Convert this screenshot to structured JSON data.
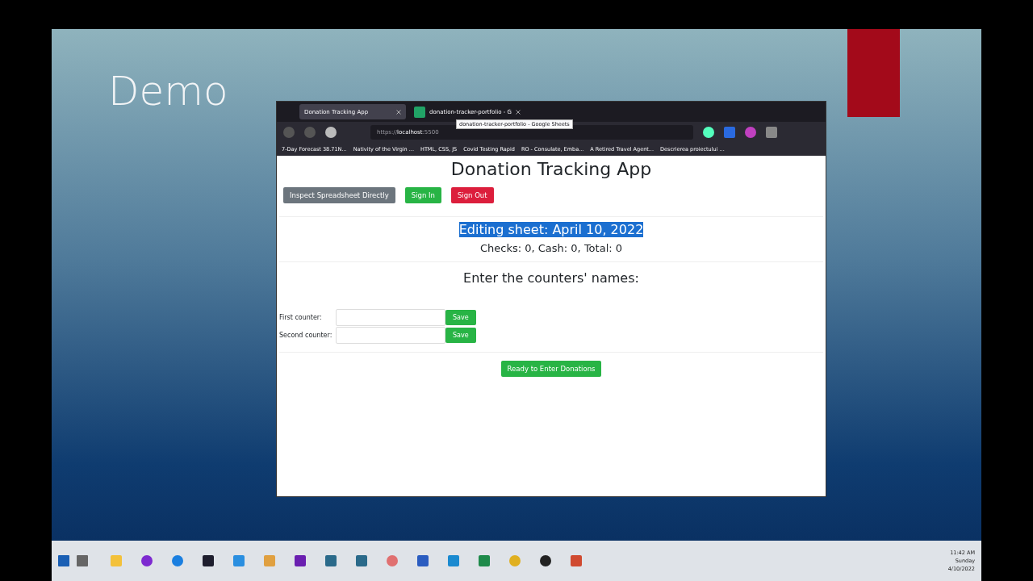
{
  "slide": {
    "title": "Demo"
  },
  "browser": {
    "tabs": [
      {
        "label": "Donation Tracking App",
        "selected": true
      },
      {
        "label": "donation-tracker-portfolio - G",
        "selected": false
      }
    ],
    "tooltip": "donation-tracker-portfolio - Google Sheets",
    "url_prefix": "https://",
    "url_host": "localhost",
    "url_port": ":5500",
    "bookmarks": [
      "7-Day Forecast 38.71N...",
      "Nativity of the Virgin ...",
      "HTML, CSS, JS",
      "Covid Testing Rapid",
      "RO - Consulate, Emba...",
      "A Retired Travel Agent...",
      "Descrierea proiectului ..."
    ]
  },
  "page": {
    "title": "Donation Tracking App",
    "buttons": [
      {
        "label": "Inspect Spreadsheet Directly",
        "kind": "secondary"
      },
      {
        "label": "Sign In",
        "kind": "success"
      },
      {
        "label": "Sign Out",
        "kind": "danger"
      }
    ],
    "sheet": {
      "text": "Editing sheet: April 10, 2022",
      "highlighted": true
    },
    "totals": "Checks: 0, Cash: 0, Total: 0",
    "prompt": "Enter the counters' names:",
    "counters": [
      {
        "label": "First counter:",
        "button": "Save"
      },
      {
        "label": "Second counter:",
        "button": "Save"
      }
    ],
    "ready_button": "Ready to Enter Donations"
  },
  "taskbar": {
    "clock": {
      "time": "11:42 AM",
      "day": "Sunday",
      "date": "4/10/2022"
    }
  }
}
